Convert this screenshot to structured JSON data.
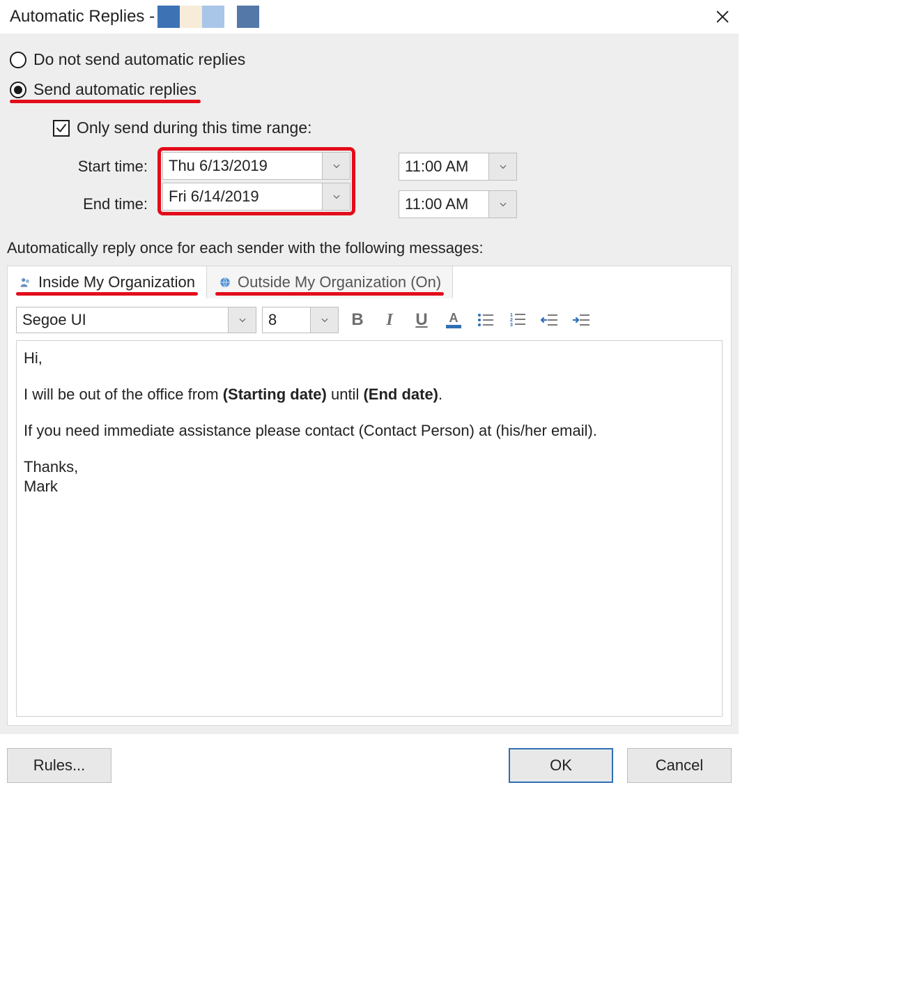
{
  "titlebar": {
    "title": "Automatic Replies - ",
    "swatches": [
      "#3d72b5",
      "#f6ecd9",
      "#a9c6e8",
      "#5478a8"
    ]
  },
  "radios": {
    "do_not_send": "Do not send automatic replies",
    "send": "Send automatic replies"
  },
  "time_range": {
    "checkbox_label": "Only send during this time range:",
    "start_label": "Start time:",
    "end_label": "End time:",
    "start_date": "Thu 6/13/2019",
    "end_date": "Fri 6/14/2019",
    "start_time": "11:00 AM",
    "end_time": "11:00 AM"
  },
  "instruction": "Automatically reply once for each sender with the following messages:",
  "tabs": {
    "inside": "Inside My Organization",
    "outside": "Outside My Organization (On)"
  },
  "toolbar": {
    "font": "Segoe UI",
    "size": "8"
  },
  "message": {
    "line1": "Hi,",
    "line2_pre": "I will be out of the office from ",
    "line2_b1": "(Starting date)",
    "line2_mid": " until ",
    "line2_b2": "(End date)",
    "line2_post": ".",
    "line3": "If you need immediate assistance please contact (Contact Person) at (his/her email).",
    "line4": "Thanks,",
    "line5": "Mark"
  },
  "buttons": {
    "rules": "Rules...",
    "ok": "OK",
    "cancel": "Cancel"
  }
}
